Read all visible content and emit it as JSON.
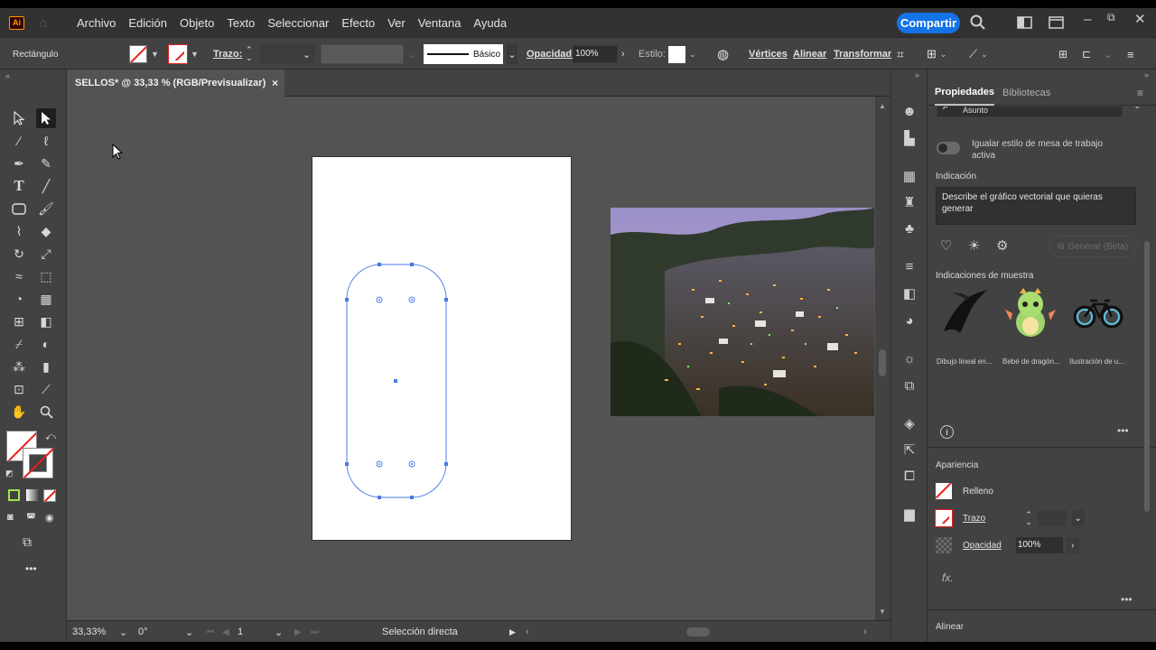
{
  "app": {
    "logo": "Ai"
  },
  "menubar": {
    "items": [
      "Archivo",
      "Edición",
      "Objeto",
      "Texto",
      "Seleccionar",
      "Efecto",
      "Ver",
      "Ventana",
      "Ayuda"
    ],
    "share_label": "Compartir",
    "icons": [
      "home-icon",
      "search-icon",
      "arrange-documents-icon",
      "window-icon",
      "minimize-icon",
      "restore-icon",
      "close-icon"
    ]
  },
  "control_bar": {
    "object_type": "Rectángulo",
    "stroke_label": "Trazo:",
    "stroke_style": "Básico",
    "opacity_label": "Opacidad:",
    "opacity_value": "100%",
    "style_label": "Estilo:",
    "vertices_label": "Vértices",
    "align_label": "Alinear",
    "transform_label": "Transformar"
  },
  "document": {
    "tab_title": "SELLOS* @ 33,33 % (RGB/Previsualizar)",
    "close_symbol": "×"
  },
  "status_bar": {
    "zoom": "33,33%",
    "rotation": "0°",
    "artboard_number": "1",
    "tool_name": "Selección directa"
  },
  "properties_panel": {
    "tabs": [
      "Propiedades",
      "Bibliotecas"
    ],
    "subject_label": "Asunto",
    "toggle_label_1": "Igualar estilo de mesa de trabajo",
    "toggle_label_2": "activa",
    "prompt_section": "Indicación",
    "prompt_line_1": "Describe el gráfico vectorial que quieras",
    "prompt_line_2": "generar",
    "generate_label": "Generar (Beta)",
    "samples_title": "Indicaciones de muestra",
    "samples": [
      "Dibujo lineal en...",
      "Bebé de dragón...",
      "Ilustración de u..."
    ],
    "appearance_title": "Apariencia",
    "fill_label": "Relleno",
    "stroke_label": "Trazo",
    "opacity_label": "Opacidad",
    "opacity_value": "100%",
    "fx_label": "fx.",
    "align_title": "Alinear",
    "more": "•••"
  },
  "tools": {
    "more": "•••"
  },
  "colors": {
    "accent": "#1473e6",
    "selection": "#4b78e6",
    "ui_dark": "#323232",
    "ui_mid": "#424242",
    "canvas": "#535353"
  }
}
